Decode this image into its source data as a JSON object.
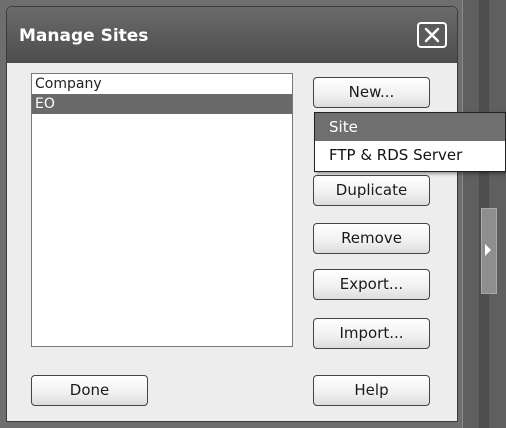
{
  "dialog": {
    "title": "Manage Sites"
  },
  "sites": [
    {
      "label": "Company",
      "selected": false
    },
    {
      "label": "EO",
      "selected": true
    }
  ],
  "buttons": {
    "new": "New...",
    "duplicate": "Duplicate",
    "remove": "Remove",
    "export": "Export...",
    "import": "Import...",
    "done": "Done",
    "help": "Help"
  },
  "new_menu": {
    "items": [
      {
        "label": "Site",
        "highlighted": true
      },
      {
        "label": "FTP & RDS Server",
        "highlighted": false
      }
    ]
  },
  "icons": {
    "close": "close-icon",
    "splitter_arrow": "arrow-right-icon"
  },
  "colors": {
    "titlebar": "#5a5a5a",
    "selection": "#6a6a6a",
    "dialog_bg": "#ededed"
  }
}
